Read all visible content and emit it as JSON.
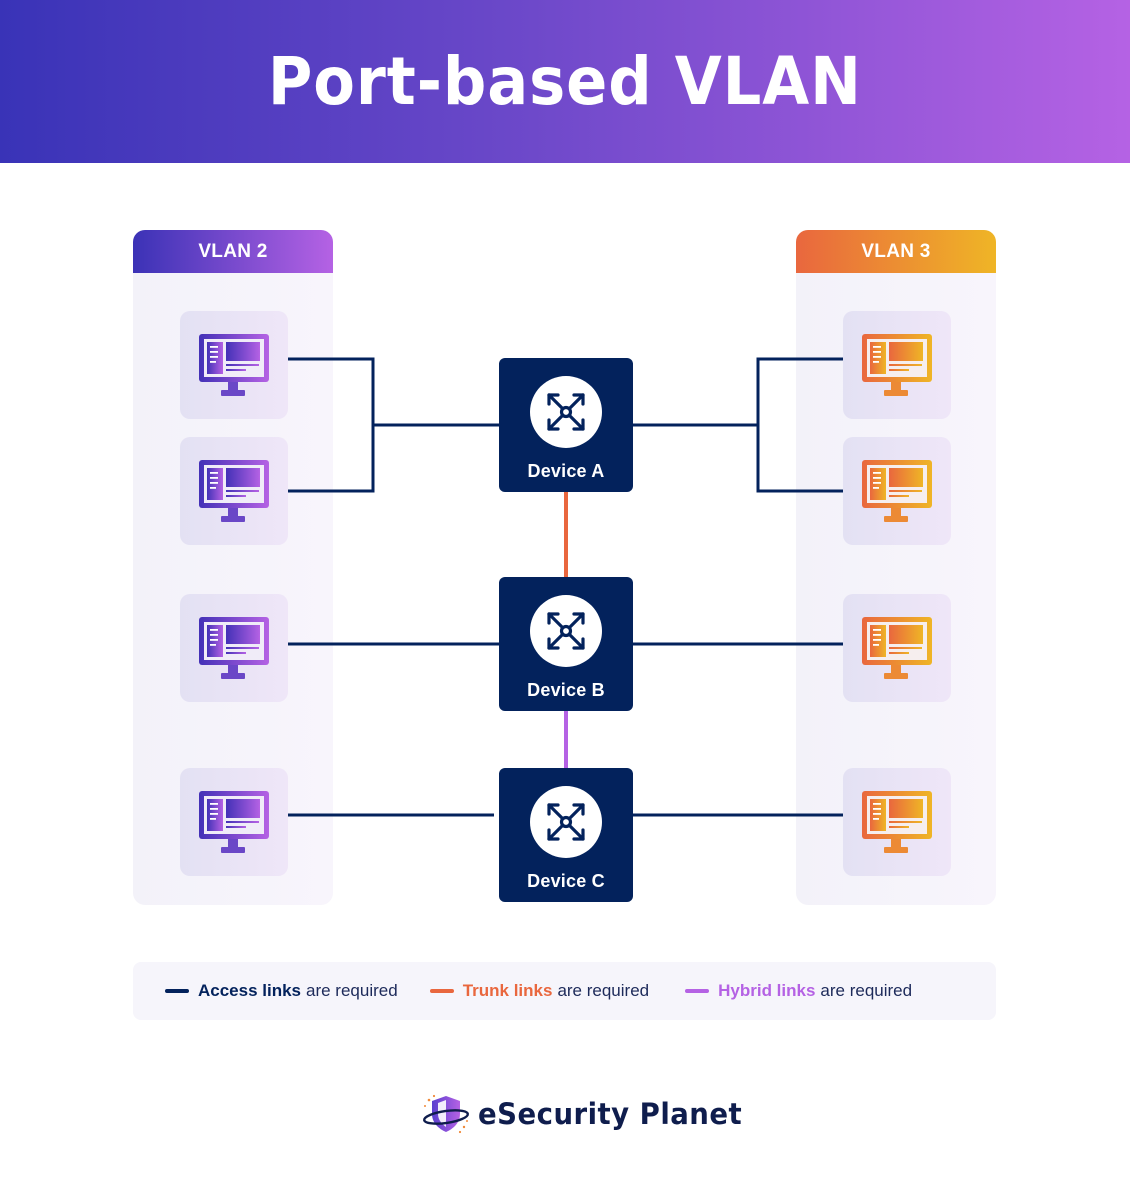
{
  "title": "Port-based VLAN",
  "vlans": [
    {
      "name": "VLAN 2",
      "side": "left",
      "gradient": [
        "#3b32b6",
        "#b562e4"
      ],
      "computers": 4
    },
    {
      "name": "VLAN 3",
      "side": "right",
      "gradient": [
        "#e9673e",
        "#efb526"
      ],
      "computers": 4
    }
  ],
  "devices": [
    {
      "label": "Device A",
      "icon": "move-arrows-icon"
    },
    {
      "label": "Device B",
      "icon": "move-arrows-icon"
    },
    {
      "label": "Device C",
      "icon": "move-arrows-icon"
    }
  ],
  "links": [
    {
      "from": "Device A",
      "to": "VLAN 2 computers 1-2",
      "type": "access"
    },
    {
      "from": "Device A",
      "to": "VLAN 3 computers 1-2",
      "type": "access"
    },
    {
      "from": "Device B",
      "to": "VLAN 2 computer 3",
      "type": "access"
    },
    {
      "from": "Device B",
      "to": "VLAN 3 computer 3",
      "type": "access"
    },
    {
      "from": "Device C",
      "to": "VLAN 2 computer 4",
      "type": "access"
    },
    {
      "from": "Device C",
      "to": "VLAN 3 computer 4",
      "type": "access"
    },
    {
      "from": "Device A",
      "to": "Device B",
      "type": "trunk"
    },
    {
      "from": "Device B",
      "to": "Device C",
      "type": "hybrid"
    }
  ],
  "colors": {
    "access": "#03225c",
    "trunk": "#e9673e",
    "hybrid": "#b562e4",
    "device_bg": "#03225c"
  },
  "legend": [
    {
      "strong": "Access links",
      "rest": "are required",
      "color": "#03225c"
    },
    {
      "strong": "Trunk links",
      "rest": "are required",
      "color": "#e9673e"
    },
    {
      "strong": "Hybrid links",
      "rest": "are required",
      "color": "#b562e4"
    }
  ],
  "logo": {
    "text": "eSecurity Planet",
    "icon": "shield-planet-icon"
  }
}
